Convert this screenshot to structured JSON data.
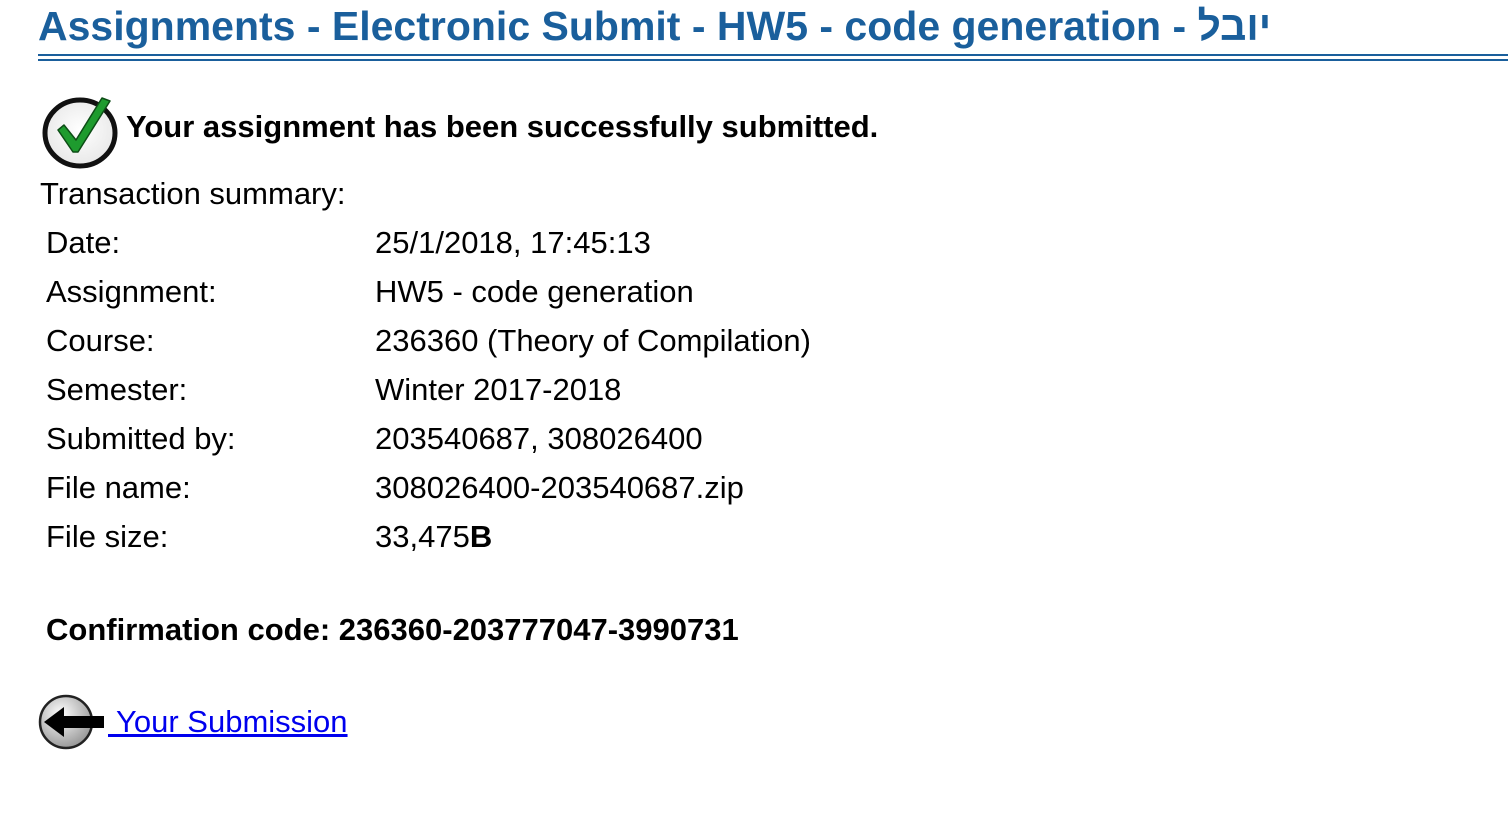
{
  "header": {
    "title": "Assignments - Electronic Submit - HW5 - code generation - יובל"
  },
  "status": {
    "icon": "success-checkmark-icon",
    "message": "Your assignment has been successfully submitted."
  },
  "summary": {
    "heading": "Transaction summary:",
    "rows": [
      {
        "label": "Date:",
        "value": "25/1/2018, 17:45:13"
      },
      {
        "label": "Assignment:",
        "value": "HW5 - code generation"
      },
      {
        "label": "Course:",
        "value": "236360 (Theory of Compilation)"
      },
      {
        "label": "Semester:",
        "value": "Winter 2017-2018"
      },
      {
        "label": "Submitted by:",
        "value": "203540687, 308026400"
      },
      {
        "label": "File name:",
        "value": "308026400-203540687.zip"
      },
      {
        "label": "File size:",
        "value": "33,475",
        "unit": "B"
      }
    ]
  },
  "confirmation": {
    "label": "Confirmation code:",
    "code": "236360-203777047-3990731"
  },
  "navigation": {
    "back_icon": "back-arrow-icon",
    "back_label": " Your Submission"
  },
  "colors": {
    "title": "#1a5f9c",
    "link": "#0000ee",
    "check": "#1e9b2e"
  }
}
